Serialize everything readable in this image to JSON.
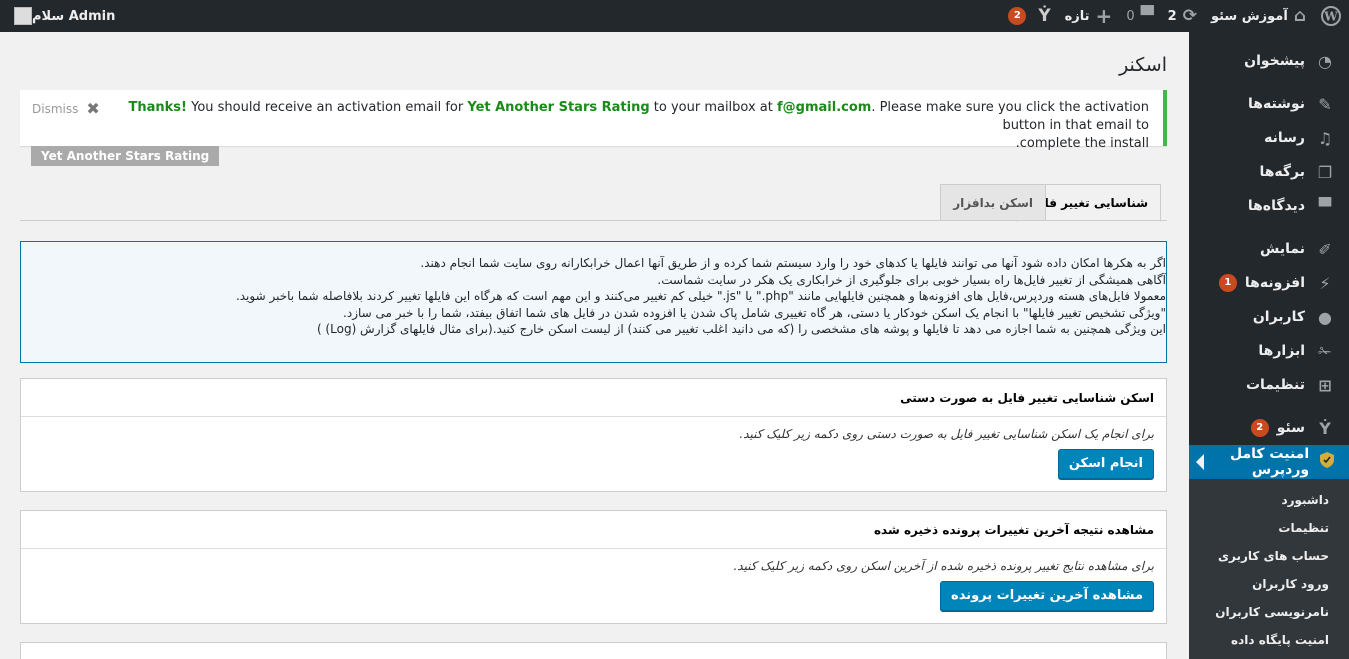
{
  "adminbar": {
    "site_name": "آموزش سئو",
    "updates_count": "2",
    "comments_count": "0",
    "new_label": "تازه",
    "yoast_badge": "2",
    "greeting": "سلام Admin"
  },
  "sidebar": {
    "items": [
      {
        "label": "پیشخوان",
        "icon": "dashboard-icon"
      },
      {
        "label": "نوشته‌ها",
        "icon": "pin-icon"
      },
      {
        "label": "رسانه",
        "icon": "media-icon"
      },
      {
        "label": "برگه‌ها",
        "icon": "pages-icon"
      },
      {
        "label": "دیدگاه‌ها",
        "icon": "comments-icon"
      },
      {
        "label": "نمایش",
        "icon": "appearance-icon"
      },
      {
        "label": "افزونه‌ها",
        "icon": "plugins-icon",
        "badge": "1"
      },
      {
        "label": "کاربران",
        "icon": "users-icon"
      },
      {
        "label": "ابزارها",
        "icon": "tools-icon"
      },
      {
        "label": "تنظیمات",
        "icon": "settings-icon"
      },
      {
        "label": "سئو",
        "icon": "yoast-icon",
        "badge": "2"
      },
      {
        "label": "امنیت کامل وردپرس",
        "icon": "shield-icon"
      }
    ],
    "submenu": [
      "داشبورد",
      "تنظیمات",
      "حساب های کاربری",
      "ورود کاربران",
      "نامرنویسی کاربران",
      "امنیت پایگاه داده"
    ]
  },
  "page": {
    "title": "اسکنر"
  },
  "notice": {
    "thanks": "Thanks!",
    "text1": " You should receive an activation email for ",
    "plugin": "Yet Another Stars Rating",
    "text2": " to your mailbox at ",
    "email": "f@gmail.com",
    "text3": ". Please make sure you click the activation button in that email to",
    "text4": ".complete the install",
    "dismiss": "Dismiss"
  },
  "plugin_tag": "Yet Another Stars Rating",
  "tabs": {
    "active": "شناسایی تغییر فایل",
    "other": "اسکن بدافزار"
  },
  "info": {
    "lines": [
      "اگر به هکرها امکان داده شود آنها می توانند فایلها یا کدهای خود را وارد سیستم شما کرده و از طریق آنها اعمال خرابکارانه روی سایت شما انجام دهند.",
      "آگاهی همیشگی از تغییر فایل‌ها راه بسیار خوبی برای جلوگیری از خرابکاری یک هکر در سایت شماست.",
      "معمولا فایل‌های هسته وردپرس،فایل های افزونه‌ها و همچنین فایلهایی مانند \"php.\" یا \"js.\" خیلی کم تغییر می‌کنند و این مهم است که هرگاه این فایلها تغییر کردند بلافاصله شما باخبر شوید.",
      "\"ویژگی تشخیص تغییر فایلها\" با انجام یک اسکن خودکار یا دستی، هر گاه تغییری شامل پاک شدن یا افزوده شدن در فایل های شما اتفاق بیفتد، شما را با خبر می سازد.",
      "این ویژگی همچنین به شما اجازه می دهد تا فایلها و پوشه های مشخصی را (که می دانید اغلب تغییر می کنند) از لیست اسکن خارج کنید.(برای مثال فایلهای گزارش (Log) )"
    ]
  },
  "box1": {
    "title": "اسکن شناسایی تغییر فایل به صورت دستی",
    "desc": "برای انجام یک اسکن شناسایی تغییر فایل به صورت دستی روی دکمه زیر کلیک کنید.",
    "button": "انجام اسکن"
  },
  "box2": {
    "title": "مشاهده نتیجه آخرین تغییرات پرونده ذخیره شده",
    "desc": "برای مشاهده نتایج تغییر پرونده ذخیره شده از آخرین اسکن روی دکمه زیر کلیک کنید.",
    "button": "مشاهده آخرین تغییرات پرونده"
  },
  "colors": {
    "adminbar": "#23282d",
    "accent": "#0073aa",
    "notice_border": "#46b450",
    "badge": "#ca4a1f"
  }
}
